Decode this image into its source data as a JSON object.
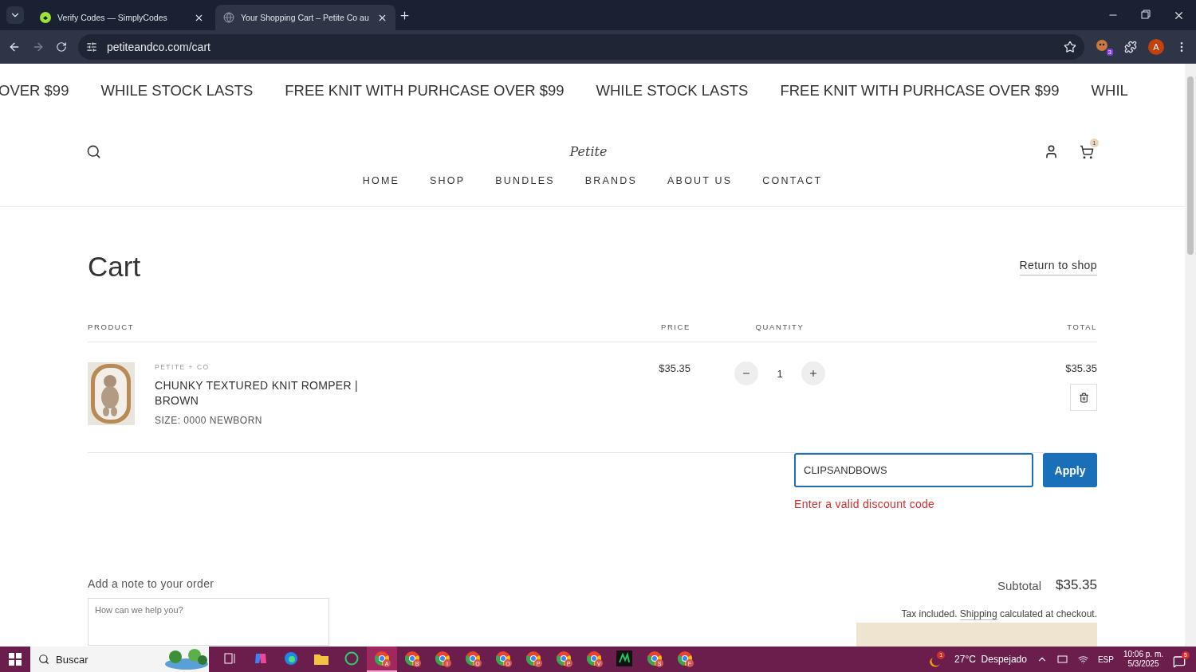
{
  "browser": {
    "tabs": [
      {
        "title": "Verify Codes — SimplyCodes",
        "selected": false,
        "kind": "simplycodes"
      },
      {
        "title": "Your Shopping Cart – Petite Co au",
        "selected": true,
        "kind": "globe"
      }
    ],
    "address": "petiteandco.com/cart",
    "extension_badge": "3",
    "profile": "A"
  },
  "marquee": [
    "OVER $99",
    "WHILE STOCK LASTS",
    "FREE KNIT WITH PURHCASE OVER $99",
    "WHILE STOCK LASTS",
    "FREE KNIT WITH PURHCASE OVER $99",
    "WHIL"
  ],
  "header": {
    "logo": "Petite",
    "cart_count": "1",
    "nav": [
      "HOME",
      "SHOP",
      "BUNDLES",
      "BRANDS",
      "ABOUT US",
      "CONTACT"
    ]
  },
  "cart": {
    "title": "Cart",
    "return_link": "Return to shop",
    "columns": [
      "PRODUCT",
      "PRICE",
      "QUANTITY",
      "TOTAL"
    ],
    "items": [
      {
        "vendor": "PETITE + CO",
        "name": "CHUNKY TEXTURED KNIT ROMPER | BROWN",
        "variant": "SIZE: 0000 NEWBORN",
        "price": "$35.35",
        "quantity": "1",
        "total": "$35.35"
      }
    ]
  },
  "discount": {
    "value": "CLIPSANDBOWS",
    "button": "Apply",
    "error": "Enter a valid discount code"
  },
  "note": {
    "label": "Add a note to your order",
    "placeholder": "How can we help you?"
  },
  "summary": {
    "subtotal_label": "Subtotal",
    "subtotal": "$35.35",
    "tax_before": "Tax included.",
    "shipping_link": "Shipping",
    "tax_after": "calculated at checkout."
  },
  "taskbar": {
    "search": "Buscar",
    "apps": [
      {
        "kind": "chrome",
        "badge": "A",
        "selected": true
      },
      {
        "kind": "chrome",
        "badge": "B",
        "selected": false
      },
      {
        "kind": "chrome",
        "badge": "I",
        "selected": false
      },
      {
        "kind": "chrome",
        "badge": "O",
        "selected": false
      },
      {
        "kind": "chrome",
        "badge": "O",
        "selected": false
      },
      {
        "kind": "chrome",
        "badge": "P",
        "selected": false
      },
      {
        "kind": "chrome",
        "badge": "P",
        "selected": false
      },
      {
        "kind": "chrome",
        "badge": "V",
        "selected": false
      },
      {
        "kind": "square",
        "selected": false
      },
      {
        "kind": "chrome",
        "badge": "S",
        "selected": false
      },
      {
        "kind": "chrome",
        "badge": "F",
        "selected": false
      }
    ],
    "weather_badge": "1",
    "weather": "27°C  Despejado",
    "language": "ESP",
    "time": "10:06 p. m.",
    "date": "5/3/2025",
    "notifications": "5"
  }
}
